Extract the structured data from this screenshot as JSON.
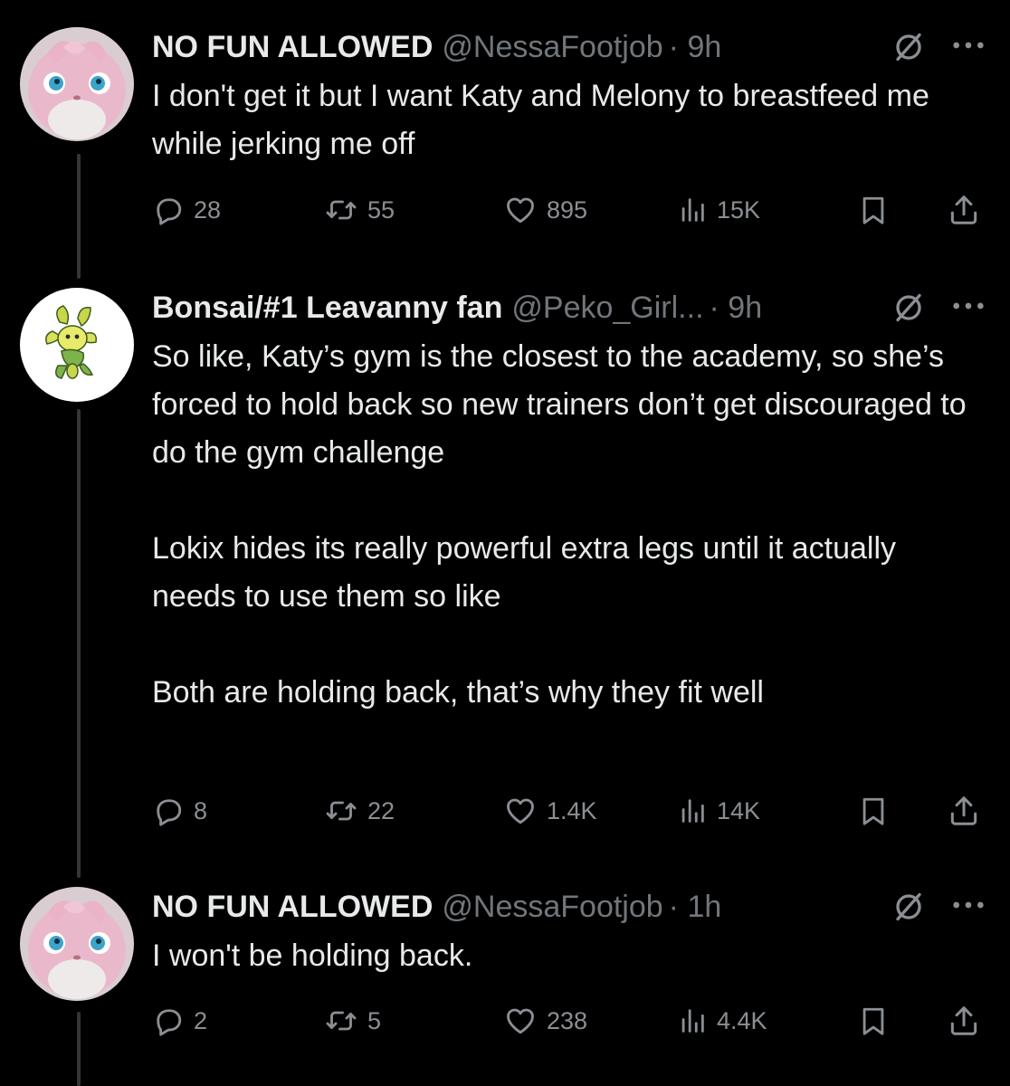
{
  "tweets": [
    {
      "name": "NO FUN ALLOWED",
      "handle": "@NessaFootjob",
      "time": "· 9h",
      "text": [
        "I don't get it but I want Katy and Melony to breastfeed me while jerking me off"
      ],
      "replies": "28",
      "retweets": "55",
      "likes": "895",
      "views": "15K"
    },
    {
      "name": "Bonsai/#1 Leavanny fan",
      "handle": "@Peko_Girl...",
      "time": "· 9h",
      "text": [
        "So like, Katy’s gym is the closest to the academy, so she’s forced to hold back so new trainers don’t get discouraged to do the gym challenge",
        "",
        "Lokix hides its really powerful extra legs until it actually needs to use them so like",
        "",
        "Both are holding back, that’s why they fit well"
      ],
      "replies": "8",
      "retweets": "22",
      "likes": "1.4K",
      "views": "14K"
    },
    {
      "name": "NO FUN ALLOWED",
      "handle": "@NessaFootjob",
      "time": "· 1h",
      "text": [
        "I won't be holding back."
      ],
      "replies": "2",
      "retweets": "5",
      "likes": "238",
      "views": "4.4K"
    }
  ],
  "icons": {
    "reply": "speech-bubble-icon",
    "retweet": "retweet-arrows-icon",
    "like": "heart-icon",
    "views": "bar-chart-icon",
    "bookmark": "bookmark-icon",
    "share": "share-upload-icon",
    "grok": "slashed-circle-icon",
    "more": "ellipsis-icon"
  },
  "colors": {
    "background": "#000000",
    "text": "#e7e9ea",
    "secondary": "#71767b",
    "line": "#333639"
  }
}
